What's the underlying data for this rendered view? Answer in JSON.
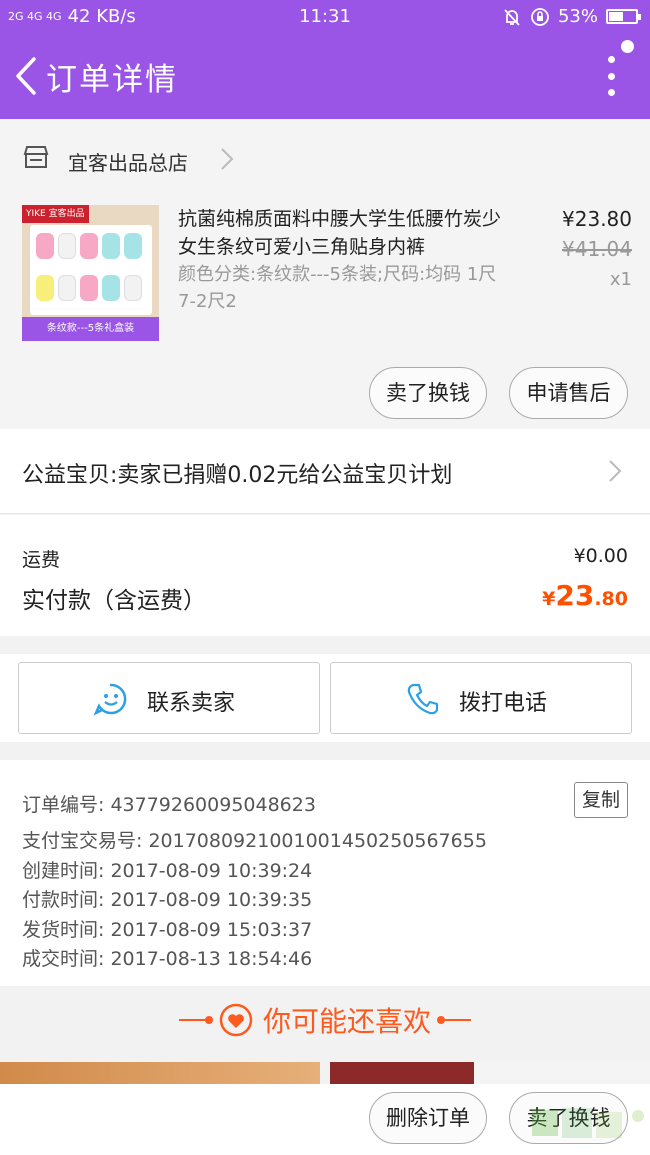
{
  "status_bar": {
    "signal": "2G 4G 4G",
    "speed": "42 KB/s",
    "time": "11:31",
    "battery": "53%",
    "battery_level": 0.53
  },
  "header": {
    "title": "订单详情"
  },
  "shop": {
    "name": "宜客出品总店"
  },
  "item": {
    "thumb_brand": "YIKE 宜客出品",
    "thumb_caption": "条纹款---5条礼盒装",
    "title": "抗菌纯棉质面料中腰大学生低腰竹炭少女生条纹可爱小三角贴身内裤",
    "spec": "颜色分类:条纹款---5条装;尺码:均码 1尺7-2尺2",
    "price": "¥23.80",
    "original_price": "¥41.04",
    "quantity": "x1",
    "btn_sell": "卖了换钱",
    "btn_aftersale": "申请售后"
  },
  "charity": {
    "text": "公益宝贝:卖家已捐赠0.02元给公益宝贝计划"
  },
  "totals": {
    "shipping_label": "运费",
    "shipping_value": "¥0.00",
    "paid_label": "实付款（含运费）",
    "paid_currency": "¥",
    "paid_int": "23",
    "paid_dec": ".80"
  },
  "contact": {
    "seller": "联系卖家",
    "call": "拨打电话"
  },
  "order_info": {
    "order_no": "订单编号: 43779260095048623",
    "copy": "复制",
    "alipay_no": "支付宝交易号: 2017080921001001450250567655",
    "created": "创建时间: 2017-08-09 10:39:24",
    "paid": "付款时间: 2017-08-09 10:39:35",
    "shipped": "发货时间: 2017-08-09 15:03:37",
    "done": "成交时间: 2017-08-13 18:54:46"
  },
  "recommend": {
    "title": "你可能还喜欢"
  },
  "bottom": {
    "delete": "删除订单",
    "sell": "卖了换钱"
  },
  "colors": {
    "primary": "#9a55e6",
    "accent": "#ff5000"
  }
}
